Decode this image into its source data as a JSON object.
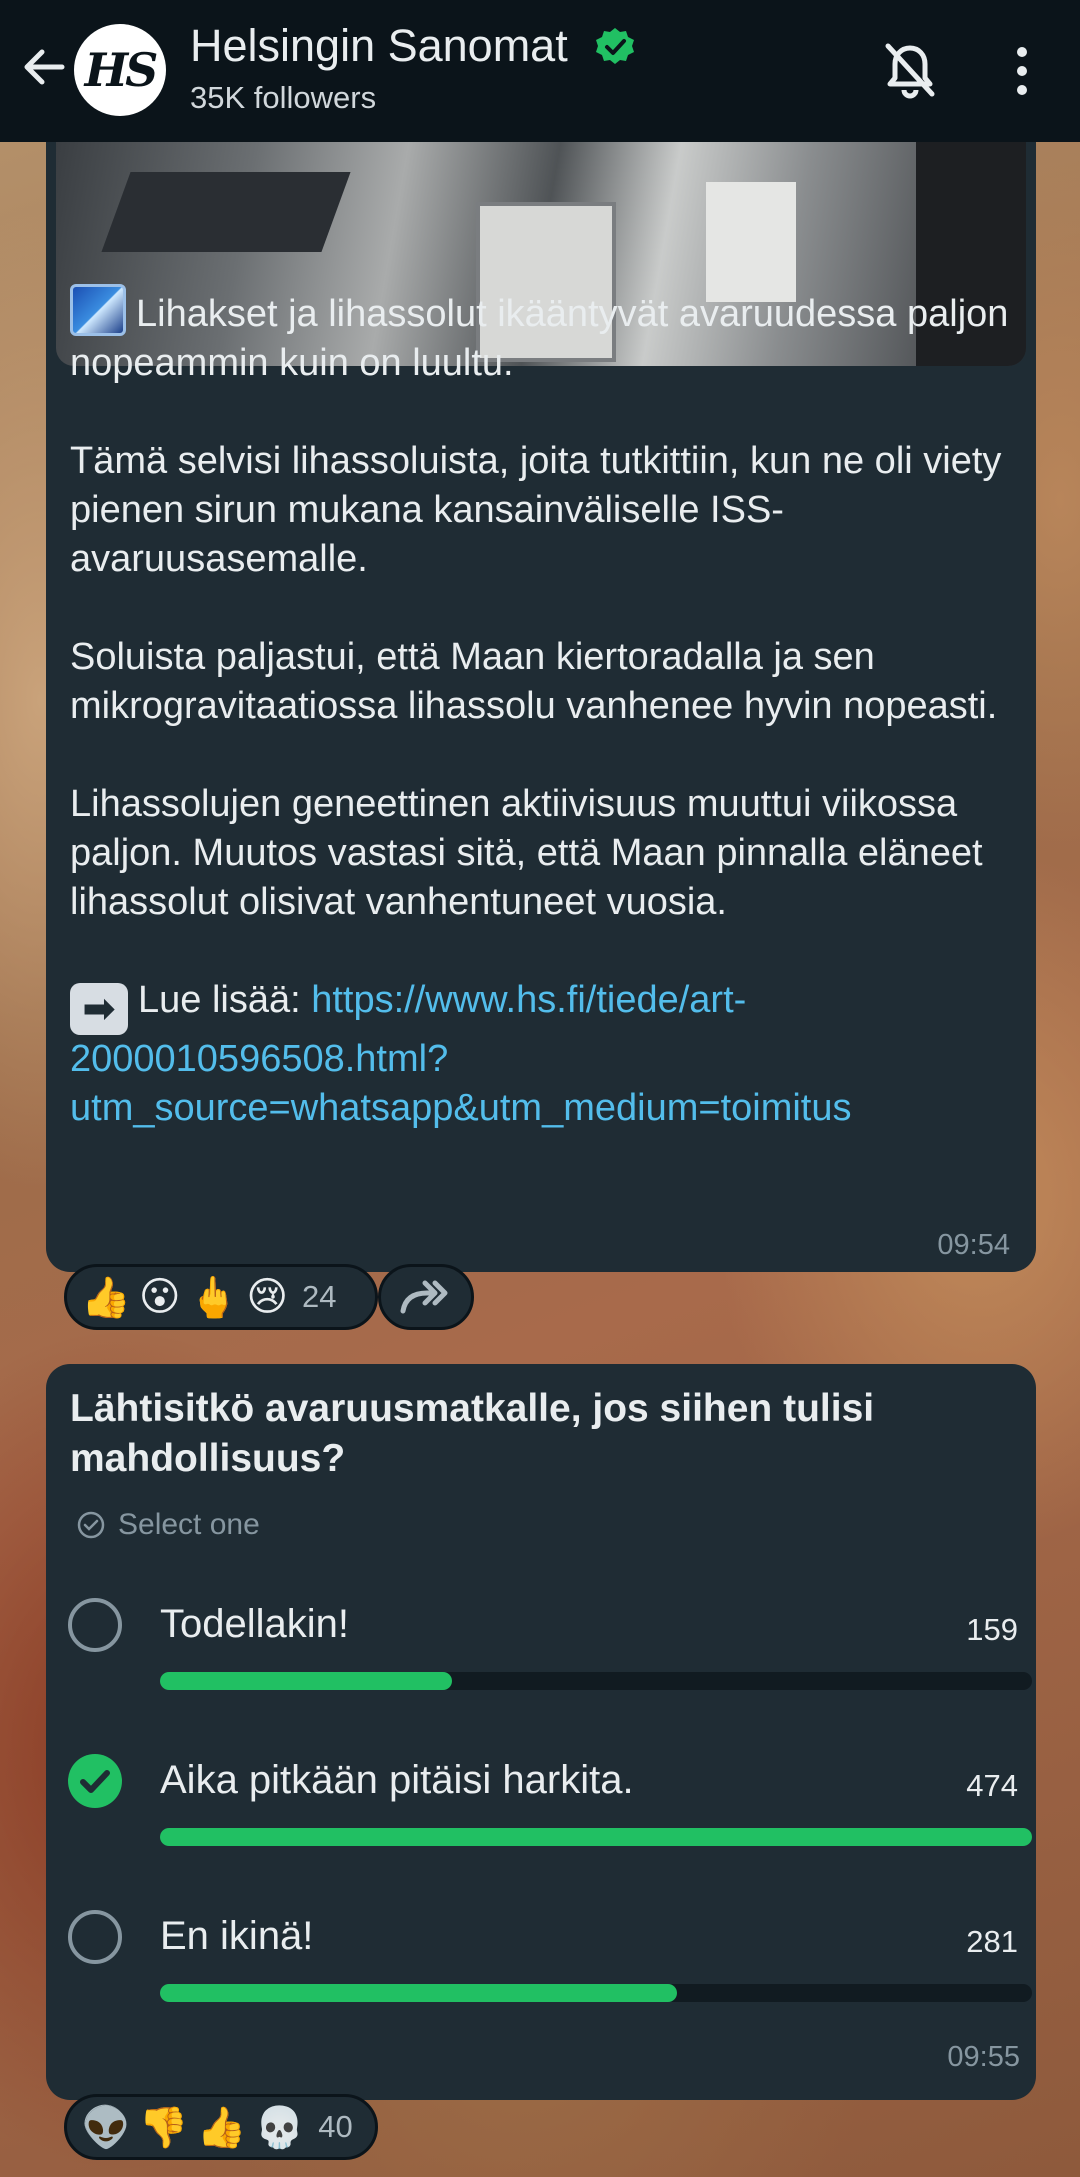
{
  "header": {
    "channel_name": "Helsingin Sanomat",
    "followers": "35K followers",
    "avatar_text": "HS",
    "icons": [
      "back-arrow-icon",
      "verified-badge-icon",
      "notifications-off-icon",
      "more-vert-icon"
    ]
  },
  "message1": {
    "paragraphs": [
      "Lihakset ja lihassolut ikääntyvät avaruudessa paljon nopeammin kuin on luultu.",
      "Tämä selvisi lihassoluista, joita tutkittiin, kun ne oli viety pienen sirun mukana kansainväliselle ISS-avaruusasemalle.",
      "Soluista paljastui, että Maan kiertoradalla ja sen mikrogravitaatiossa lihassolu vanhenee hyvin nopeasti.",
      "Lihassolujen geneettinen aktiivisuus muuttui viikossa paljon. Muutos vastasi sitä, että Maan pinnalla eläneet lihassolut olisivat vanhentuneet vuosia."
    ],
    "read_more_label": "Lue lisää: ",
    "link_text": "https://www.hs.fi/tiede/art-2000010596508.html?utm_source=whatsapp&utm_medium=toimitus",
    "time": "09:54",
    "reactions": [
      "👍",
      "😮",
      "🖕",
      "😢"
    ],
    "reaction_count": "24"
  },
  "poll": {
    "question": "Lähtisitkö avaruusmatkalle, jos siihen tulisi mahdollisuus?",
    "select_label": "Select one",
    "options": [
      {
        "label": "Todellakin!",
        "count": "159",
        "fraction": 0.335,
        "checked": false
      },
      {
        "label": "Aika pitkään pitäisi harkita.",
        "count": "474",
        "fraction": 1.0,
        "checked": true
      },
      {
        "label": "En ikinä!",
        "count": "281",
        "fraction": 0.593,
        "checked": false
      }
    ],
    "time": "09:55",
    "reactions": [
      "👽",
      "👎",
      "👍",
      "💀"
    ],
    "reaction_count": "40"
  },
  "colors": {
    "header_bg": "#0b141a",
    "bubble_bg": "#1f2c34",
    "accent_green": "#21c063",
    "link": "#53bdeb",
    "meta_text": "#8696a0"
  }
}
